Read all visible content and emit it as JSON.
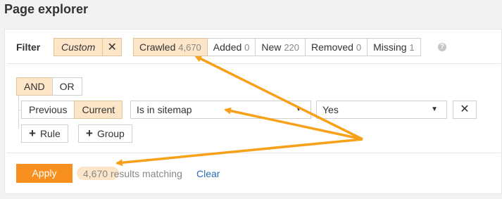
{
  "page": {
    "title": "Page explorer"
  },
  "filter": {
    "label": "Filter",
    "custom_chip": {
      "label": "Custom",
      "remove_symbol": "✕"
    },
    "tabs": [
      {
        "label": "Crawled",
        "count": "4,670",
        "active": true
      },
      {
        "label": "Added",
        "count": "0",
        "active": false
      },
      {
        "label": "New",
        "count": "220",
        "active": false
      },
      {
        "label": "Removed",
        "count": "0",
        "active": false
      },
      {
        "label": "Missing",
        "count": "1",
        "active": false
      }
    ],
    "help_icon": "question-circle-icon"
  },
  "rules": {
    "logic": {
      "and_label": "AND",
      "or_label": "OR",
      "selected": "AND"
    },
    "scope": {
      "previous_label": "Previous",
      "current_label": "Current",
      "selected": "Current"
    },
    "condition": {
      "value": "Is in sitemap"
    },
    "value_select": {
      "value": "Yes"
    },
    "delete_symbol": "✕",
    "add_rule_label": "Rule",
    "add_group_label": "Group"
  },
  "footer": {
    "apply_label": "Apply",
    "results_count": "4,670",
    "results_suffix": "results matching",
    "clear_label": "Clear"
  },
  "colors": {
    "accent_orange": "#f7901e",
    "chip_highlight": "#fde5c8",
    "annotation_arrow": "#f7a11a",
    "link_blue": "#2a6bb5"
  }
}
